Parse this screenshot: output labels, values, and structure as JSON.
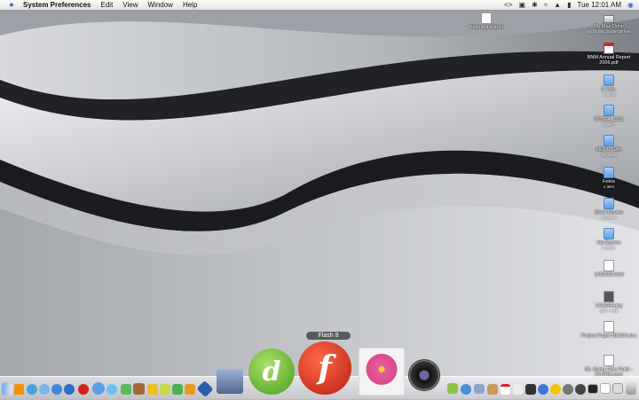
{
  "menubar": {
    "app_name": "System Preferences",
    "menus": [
      "Edit",
      "View",
      "Window",
      "Help"
    ],
    "clock": "Tue 12:01 AM"
  },
  "desktop_icons": [
    {
      "label": "Payment March",
      "sub": "",
      "kind": "doc"
    },
    {
      "label": "My Mac Drive",
      "sub": "74.41 GB, 15.55 GB free",
      "kind": "drive"
    },
    {
      "label": "BNM Annual Report 2006.pdf",
      "sub": "",
      "kind": "pdf"
    },
    {
      "label": "8 sem.",
      "sub": "9 items",
      "kind": "folder"
    },
    {
      "label": "070324_1151",
      "sub": "1 item",
      "kind": "folder"
    },
    {
      "label": "MENU Gifts",
      "sub": "28 items",
      "kind": "folder"
    },
    {
      "label": "Fotos",
      "sub": "1 item",
      "kind": "folder"
    },
    {
      "label": "Short Movies",
      "sub": "10 items",
      "kind": "folder"
    },
    {
      "label": "Irip Egama",
      "sub": "6 items",
      "kind": "folder"
    },
    {
      "label": "1421062.html",
      "sub": "",
      "kind": "doc"
    },
    {
      "label": "1421044.jpg",
      "sub": "180 × 4KB",
      "kind": "doc"
    },
    {
      "label": "Project Paper BEGIN.doc",
      "sub": "",
      "kind": "doc"
    },
    {
      "label": "06. Kamu Citra Putih - PUTRA.mp3",
      "sub": "",
      "kind": "doc"
    }
  ],
  "dock": {
    "hover_label": "Flash 8",
    "big_icons": [
      {
        "name": "dreamweaver",
        "letter": "d",
        "color": "#6ab82e"
      },
      {
        "name": "flash",
        "letter": "f",
        "color": "#d42b1e"
      }
    ]
  }
}
